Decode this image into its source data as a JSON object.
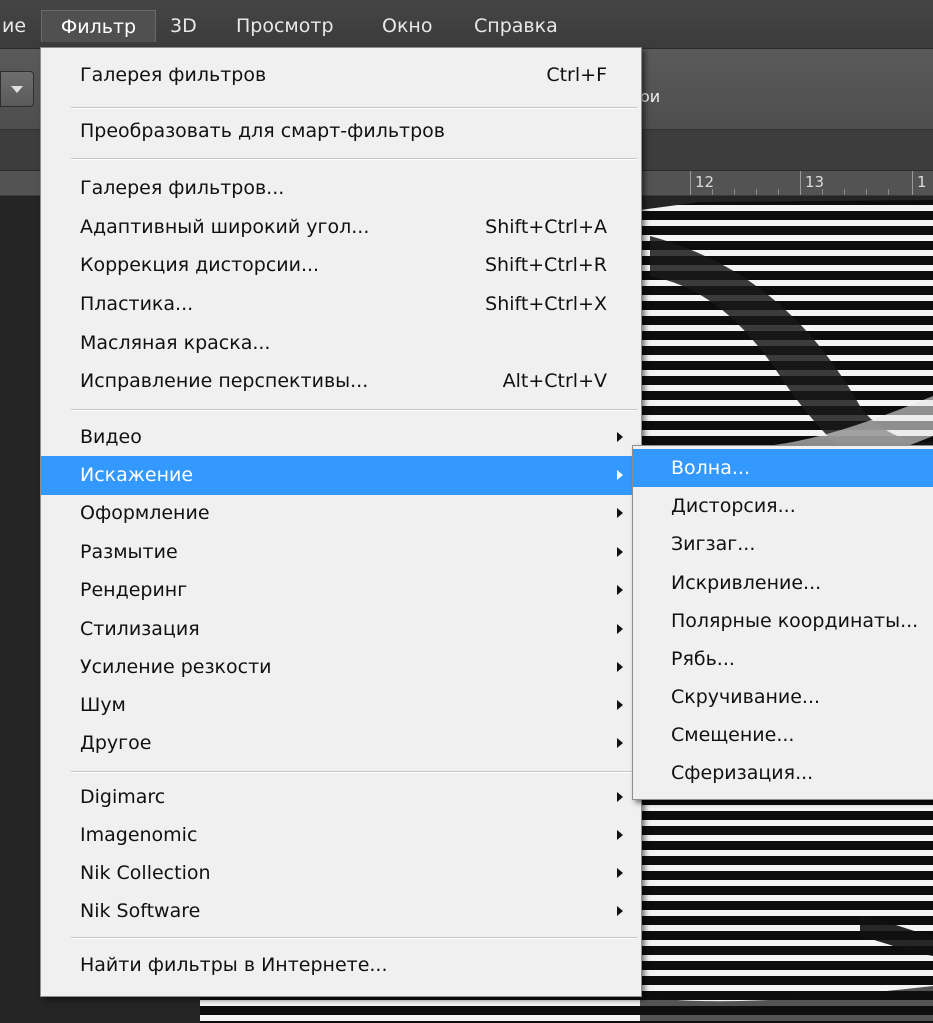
{
  "menubar": {
    "items": [
      {
        "label": "ие"
      },
      {
        "label": "Фильтр",
        "active": true
      },
      {
        "label": "3D"
      },
      {
        "label": "Просмотр"
      },
      {
        "label": "Окно"
      },
      {
        "label": "Справка"
      }
    ]
  },
  "optionsbar": {
    "partial_text": "ои"
  },
  "ruler": {
    "labels": [
      "12",
      "13",
      "1"
    ]
  },
  "filter_menu": {
    "items": [
      {
        "label": "Галерея фильтров",
        "shortcut": "Ctrl+F"
      },
      {
        "label": "Преобразовать для смарт-фильтров"
      },
      {
        "label": "Галерея фильтров..."
      },
      {
        "label": "Адаптивный широкий угол...",
        "shortcut": "Shift+Ctrl+A"
      },
      {
        "label": "Коррекция дисторсии...",
        "shortcut": "Shift+Ctrl+R"
      },
      {
        "label": "Пластика...",
        "shortcut": "Shift+Ctrl+X"
      },
      {
        "label": "Масляная краска..."
      },
      {
        "label": "Исправление перспективы...",
        "shortcut": "Alt+Ctrl+V"
      },
      {
        "label": "Видео",
        "submenu": true
      },
      {
        "label": "Искажение",
        "submenu": true,
        "highlighted": true
      },
      {
        "label": "Оформление",
        "submenu": true
      },
      {
        "label": "Размытие",
        "submenu": true
      },
      {
        "label": "Рендеринг",
        "submenu": true
      },
      {
        "label": "Стилизация",
        "submenu": true
      },
      {
        "label": "Усиление резкости",
        "submenu": true
      },
      {
        "label": "Шум",
        "submenu": true
      },
      {
        "label": "Другое",
        "submenu": true
      },
      {
        "label": "Digimarc",
        "submenu": true
      },
      {
        "label": "Imagenomic",
        "submenu": true
      },
      {
        "label": "Nik Collection",
        "submenu": true
      },
      {
        "label": "Nik Software",
        "submenu": true
      },
      {
        "label": "Найти фильтры в Интернете..."
      }
    ]
  },
  "distort_submenu": {
    "items": [
      {
        "label": "Волна...",
        "highlighted": true
      },
      {
        "label": "Дисторсия..."
      },
      {
        "label": "Зигзаг..."
      },
      {
        "label": "Искривление..."
      },
      {
        "label": "Полярные координаты..."
      },
      {
        "label": "Рябь..."
      },
      {
        "label": "Скручивание..."
      },
      {
        "label": "Смещение..."
      },
      {
        "label": "Сферизация..."
      }
    ]
  },
  "colors": {
    "highlight": "#3399ff",
    "menu_bg": "#f0f0f0",
    "menubar_bg": "#454545"
  }
}
